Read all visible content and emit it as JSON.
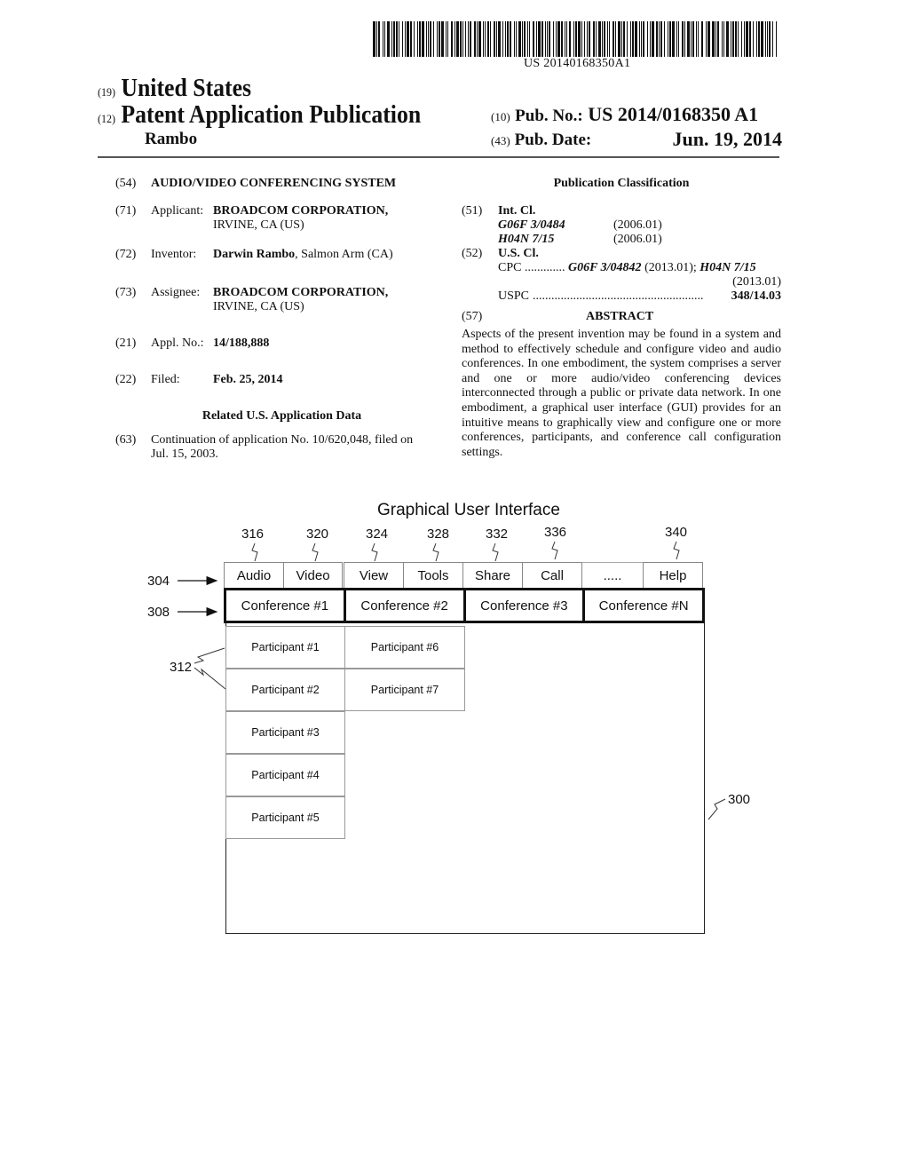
{
  "header": {
    "barcode_text": "US 20140168350A1",
    "country_code": "(19)",
    "country": "United States",
    "type_code": "(12)",
    "type": "Patent Application Publication",
    "inventor_surname": "Rambo",
    "pub_no_code": "(10)",
    "pub_no_label": "Pub. No.:",
    "pub_no": "US 2014/0168350 A1",
    "pub_date_code": "(43)",
    "pub_date_label": "Pub. Date:",
    "pub_date": "Jun. 19, 2014"
  },
  "left": {
    "title_code": "(54)",
    "title": "AUDIO/VIDEO CONFERENCING SYSTEM",
    "applicant_code": "(71)",
    "applicant_label": "Applicant:",
    "applicant_name": "BROADCOM CORPORATION,",
    "applicant_loc": "IRVINE, CA (US)",
    "inventor_code": "(72)",
    "inventor_label": "Inventor:",
    "inventor_name": "Darwin Rambo",
    "inventor_loc": ", Salmon Arm (CA)",
    "assignee_code": "(73)",
    "assignee_label": "Assignee:",
    "assignee_name": "BROADCOM CORPORATION,",
    "assignee_loc": "IRVINE, CA (US)",
    "appl_code": "(21)",
    "appl_label": "Appl. No.:",
    "appl_no": "14/188,888",
    "filed_code": "(22)",
    "filed_label": "Filed:",
    "filed_date": "Feb. 25, 2014",
    "related_heading": "Related U.S. Application Data",
    "cont_code": "(63)",
    "cont_line1": "Continuation of application No. 10/620,048, filed on",
    "cont_line2": "Jul. 15, 2003."
  },
  "right": {
    "heading": "Publication Classification",
    "intcl_code": "(51)",
    "intcl_label": "Int. Cl.",
    "intcl": [
      {
        "cls": "G06F 3/0484",
        "ver": "(2006.01)"
      },
      {
        "cls": "H04N 7/15",
        "ver": "(2006.01)"
      }
    ],
    "uscl_code": "(52)",
    "uscl_label": "U.S. Cl.",
    "cpc_label": "CPC",
    "cpc_dots": ".............",
    "cpc_cls1": "G06F 3/04842",
    "cpc_ver1": " (2013.01); ",
    "cpc_cls2": "H04N 7/15",
    "cpc_ver2": "(2013.01)",
    "uspc_label": "USPC",
    "uspc_dots": ".......................................................",
    "uspc_value": "348/14.03",
    "abstract_code": "(57)",
    "abstract_heading": "ABSTRACT",
    "abstract": "Aspects of the present invention may be found in a system and method to effectively schedule and configure video and audio conferences. In one embodiment, the system comprises a server and one or more audio/video conferencing devices interconnected through a public or private data network. In one embodiment, a graphical user interface (GUI) provides for an intuitive means to graphically view and configure one or more conferences, participants, and conference call configuration settings."
  },
  "figure": {
    "title": "Graphical User Interface",
    "menu_ref": "304",
    "conf_ref": "308",
    "participant_ref": "312",
    "window_ref": "300",
    "menu": [
      {
        "label": "Audio",
        "ref": "316"
      },
      {
        "label": "Video",
        "ref": "320"
      },
      {
        "label": "View",
        "ref": "324"
      },
      {
        "label": "Tools",
        "ref": "328"
      },
      {
        "label": "Share",
        "ref": "332"
      },
      {
        "label": "Call",
        "ref": "336"
      },
      {
        "label": ".....",
        "ref": ""
      },
      {
        "label": "Help",
        "ref": "340"
      }
    ],
    "conferences": [
      "Conference #1",
      "Conference #2",
      "Conference #3",
      "Conference #N"
    ],
    "participants_col1": [
      "Participant #1",
      "Participant #2",
      "Participant #3",
      "Participant #4",
      "Participant #5"
    ],
    "participants_col2": [
      "Participant #6",
      "Participant #7"
    ]
  }
}
